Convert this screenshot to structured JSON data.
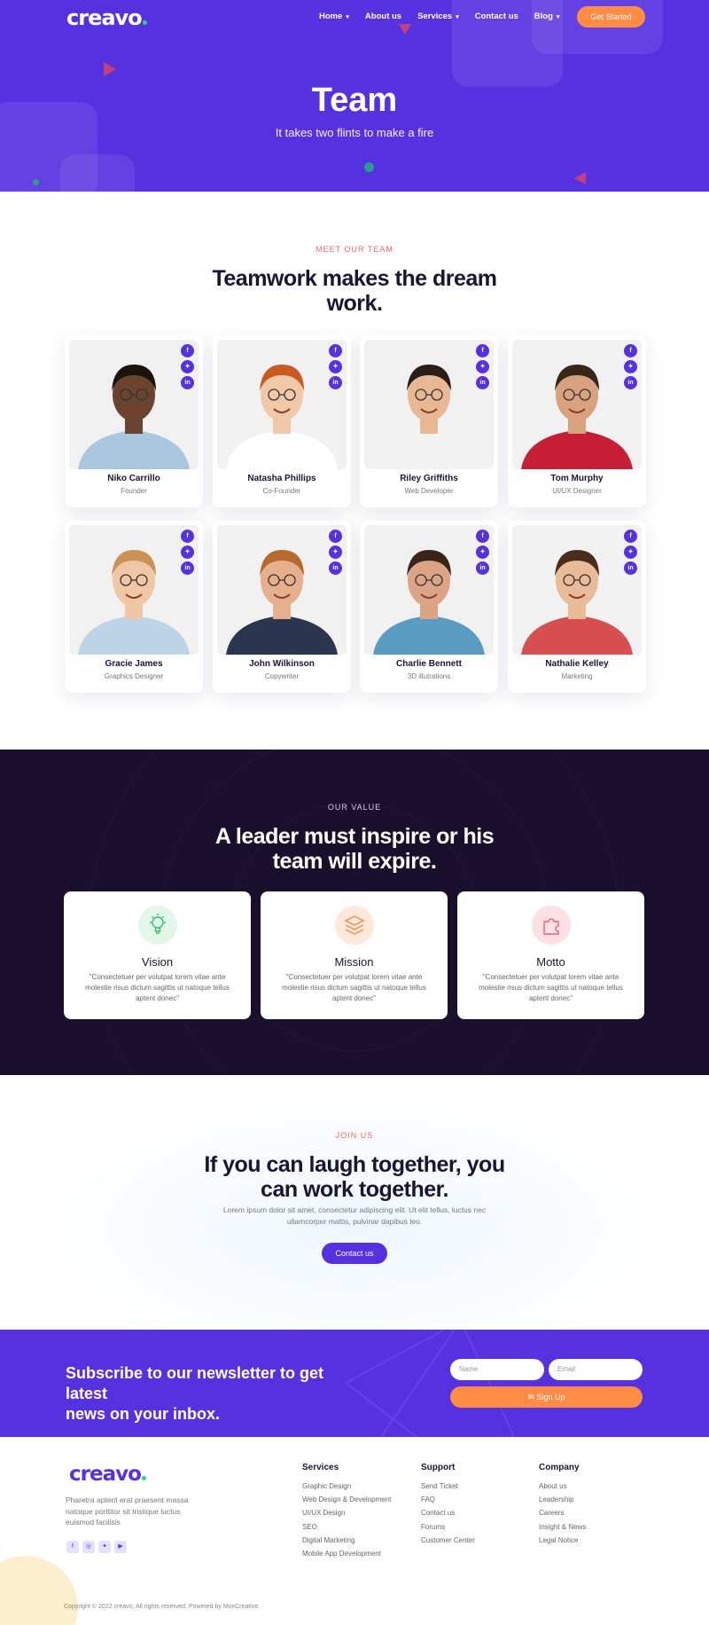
{
  "header": {
    "logo": "creavo",
    "nav": [
      {
        "label": "Home",
        "has_dropdown": true
      },
      {
        "label": "About us",
        "has_dropdown": false
      },
      {
        "label": "Services",
        "has_dropdown": true
      },
      {
        "label": "Contact us",
        "has_dropdown": false
      },
      {
        "label": "Blog",
        "has_dropdown": true
      }
    ],
    "cta": "Get Started"
  },
  "hero": {
    "title": "Team",
    "subtitle": "It takes two flints to make a fire"
  },
  "team": {
    "eyebrow": "MEET OUR TEAM",
    "heading_line1": "Teamwork makes the dream",
    "heading_line2": "work.",
    "social_icons": [
      "facebook-icon",
      "twitter-icon",
      "linkedin-icon"
    ],
    "members": [
      {
        "name": "Niko Carrillo",
        "role": "Founder"
      },
      {
        "name": "Natasha Phillips",
        "role": "Co-Founder"
      },
      {
        "name": "Riley Griffiths",
        "role": "Web Developer"
      },
      {
        "name": "Tom Murphy",
        "role": "UI/UX Designer"
      },
      {
        "name": "Gracie James",
        "role": "Graphics Designer"
      },
      {
        "name": "John Wilkinson",
        "role": "Copywriter"
      },
      {
        "name": "Charlie Bennett",
        "role": "3D illutrations"
      },
      {
        "name": "Nathalie Kelley",
        "role": "Marketing"
      }
    ]
  },
  "values": {
    "eyebrow": "OUR VALUE",
    "heading_line1": "A leader must inspire or his",
    "heading_line2": "team will expire.",
    "cards": [
      {
        "title": "Vision",
        "icon": "lightbulb-icon",
        "text": "\"Consectetuer per volutpat lorem vitae ante molestie risus dictum sagittis ut natoque tellus aptent donec\""
      },
      {
        "title": "Mission",
        "icon": "layers-icon",
        "text": "\"Consectetuer per volutpat lorem vitae ante molestie risus dictum sagittis ut natoque tellus aptent donec\""
      },
      {
        "title": "Motto",
        "icon": "puzzle-icon",
        "text": "\"Consectetuer per volutpat lorem vitae ante molestie risus dictum sagittis ut natoque tellus aptent donec\""
      }
    ]
  },
  "join": {
    "eyebrow": "JOIN US",
    "heading_line1": "If you can laugh together, you",
    "heading_line2": "can work together.",
    "text_line1": "Lorem ipsum dolor sit amet, consectetur adipiscing elit. Ut elit tellus, luctus nec",
    "text_line2": "ullamcorper mattis, pulvinar dapibus leo.",
    "button": "Contact us"
  },
  "newsletter": {
    "heading_line1": "Subscribe to our newsletter to get latest",
    "heading_line2": "news on your inbox.",
    "name_placeholder": "Name",
    "email_placeholder": "Email",
    "button": "Sign Up"
  },
  "footer": {
    "logo": "creavo",
    "description": "Pharetra aptent erat praesent massa natoque porttitor sit tristique luctus euismod facilisis",
    "social_icons": [
      "facebook-icon",
      "instagram-icon",
      "twitter-icon",
      "youtube-icon"
    ],
    "columns": [
      {
        "heading": "Services",
        "links": [
          "Graphic Design",
          "Web Design & Development",
          "UI/UX Design",
          "SEO",
          "Digital Marketing",
          "Mobile App Development"
        ]
      },
      {
        "heading": "Support",
        "links": [
          "Send Ticket",
          "FAQ",
          "Contact us",
          "Forums",
          "Customer Center"
        ]
      },
      {
        "heading": "Company",
        "links": [
          "About us",
          "Leadership",
          "Careers",
          "Insight & News",
          "Legal Notice"
        ]
      }
    ],
    "copyright": "Copyright © 2022 creavo, All rights reserved. Powered by MoxCreative."
  },
  "colors": {
    "brand": "#5631e0",
    "accent": "#ff8c42",
    "dark": "#1b0f2e",
    "eyebrow": "#f06464"
  }
}
